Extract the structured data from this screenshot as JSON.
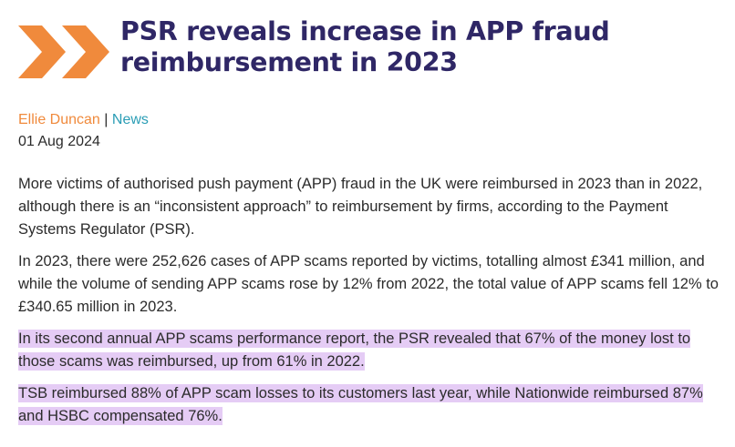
{
  "article": {
    "title": "PSR reveals increase in APP fraud reimbursement in 2023",
    "author": "Ellie Duncan",
    "separator": "|",
    "category": "News",
    "date": "01 Aug 2024",
    "paragraphs": [
      "More victims of authorised push payment (APP) fraud in the UK were reimbursed in 2023 than in 2022, although there is an “inconsistent approach” to reimbursement by firms, according to the Payment Systems Regulator (PSR).",
      "In 2023, there were 252,626 cases of APP scams reported by victims, totalling almost £341 million, and while the volume of sending APP scams rose by 12% from 2022, the total value of APP scams fell 12% to £340.65 million in 2023.",
      "In its second annual APP scams performance report, the PSR revealed that 67% of the money lost to those scams was reimbursed, up from 61% in 2022.",
      "TSB reimbursed 88% of APP scam losses to its customers last year, while Nationwide reimbursed 87% and HSBC compensated 76%."
    ]
  },
  "colors": {
    "title": "#2f2766",
    "chevrons": "#f08a3c",
    "author": "#f08a3c",
    "category": "#2a9db5",
    "highlight": "#e5ccf5"
  },
  "icons": {
    "logo": "double-chevron-right-icon"
  }
}
